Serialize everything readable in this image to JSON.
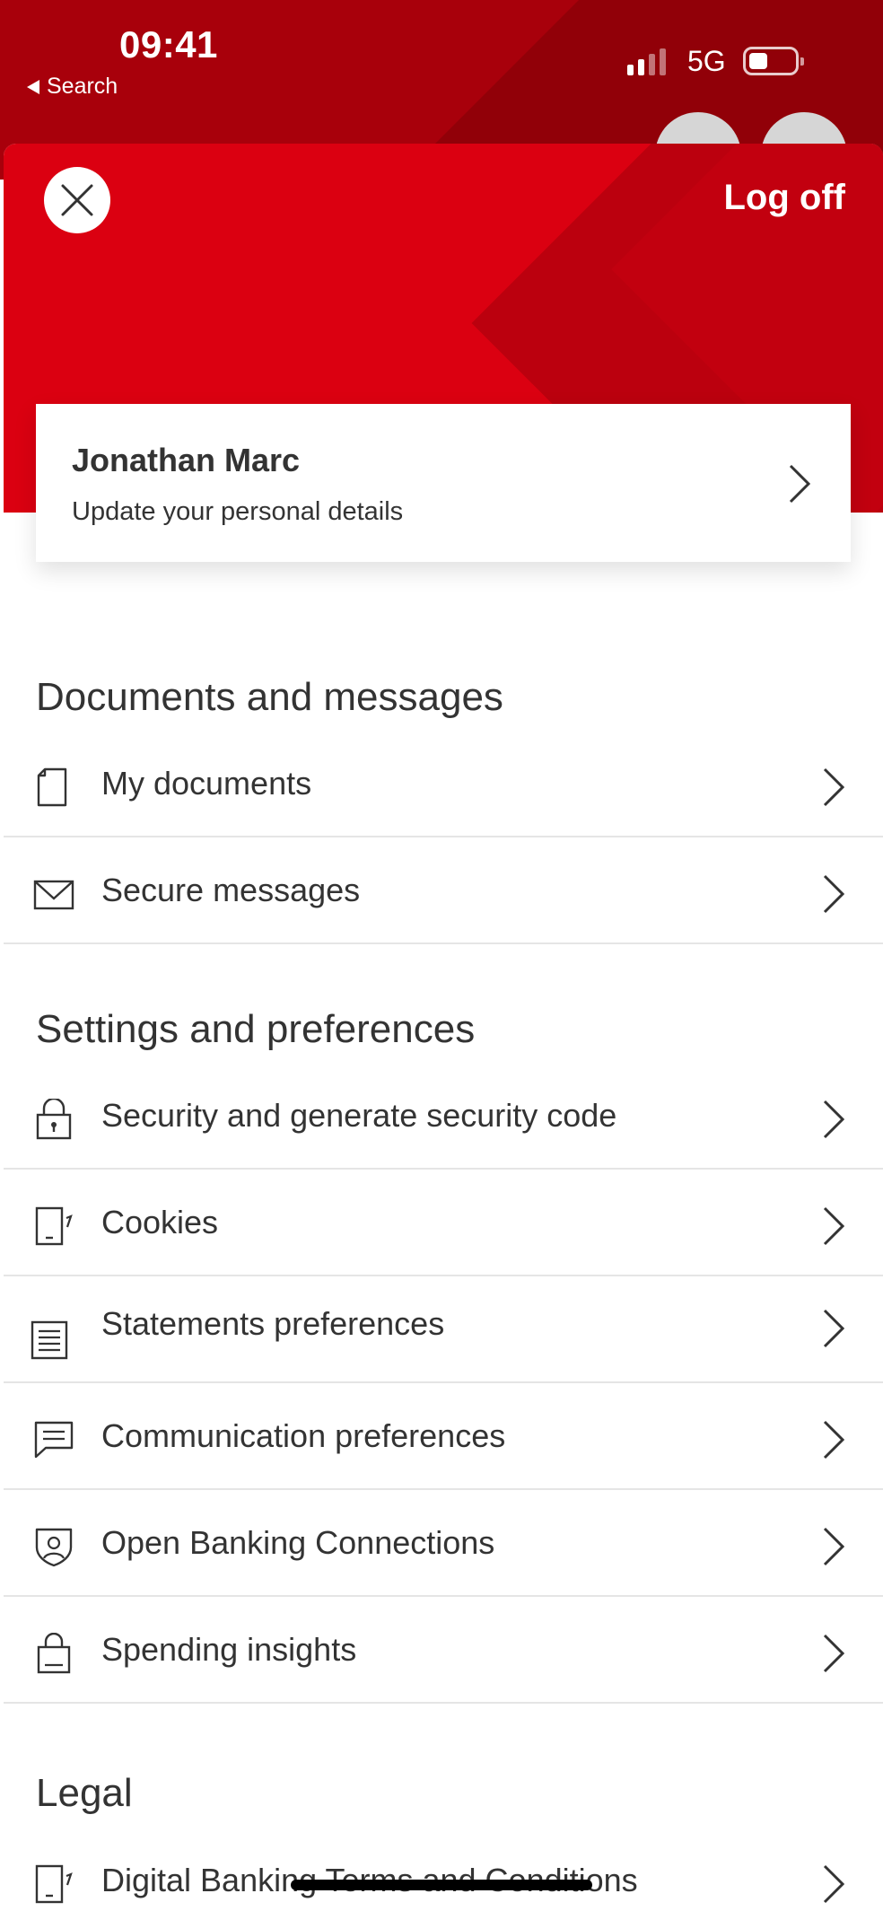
{
  "status_bar": {
    "time": "09:41",
    "back_label": "Search",
    "network": "5G",
    "signal_bars": 2,
    "battery_level": 0.3
  },
  "sheet": {
    "logoff_label": "Log off",
    "profile": {
      "name": "Jonathan Marc",
      "subtitle": "Update your personal details"
    }
  },
  "sections": {
    "documents": {
      "title": "Documents and messages",
      "items": [
        {
          "label": "My documents",
          "icon": "document-icon"
        },
        {
          "label": "Secure messages",
          "icon": "envelope-icon"
        }
      ]
    },
    "settings": {
      "title": "Settings and preferences",
      "items": [
        {
          "label": "Security and generate security code",
          "icon": "padlock-icon"
        },
        {
          "label": "Cookies",
          "icon": "device-icon"
        },
        {
          "label": "Statements preferences",
          "icon": "statement-icon"
        },
        {
          "label": "Communication preferences",
          "icon": "chat-icon"
        },
        {
          "label": "Open Banking Connections",
          "icon": "shield-icon"
        },
        {
          "label": "Spending insights",
          "icon": "bag-icon"
        }
      ]
    },
    "legal": {
      "title": "Legal",
      "items": [
        {
          "label": "Digital Banking Terms and Conditions",
          "icon": "device-icon"
        }
      ]
    }
  },
  "colors": {
    "brand_red": "#db0011",
    "text": "#333333",
    "divider": "#e5e5e5"
  }
}
